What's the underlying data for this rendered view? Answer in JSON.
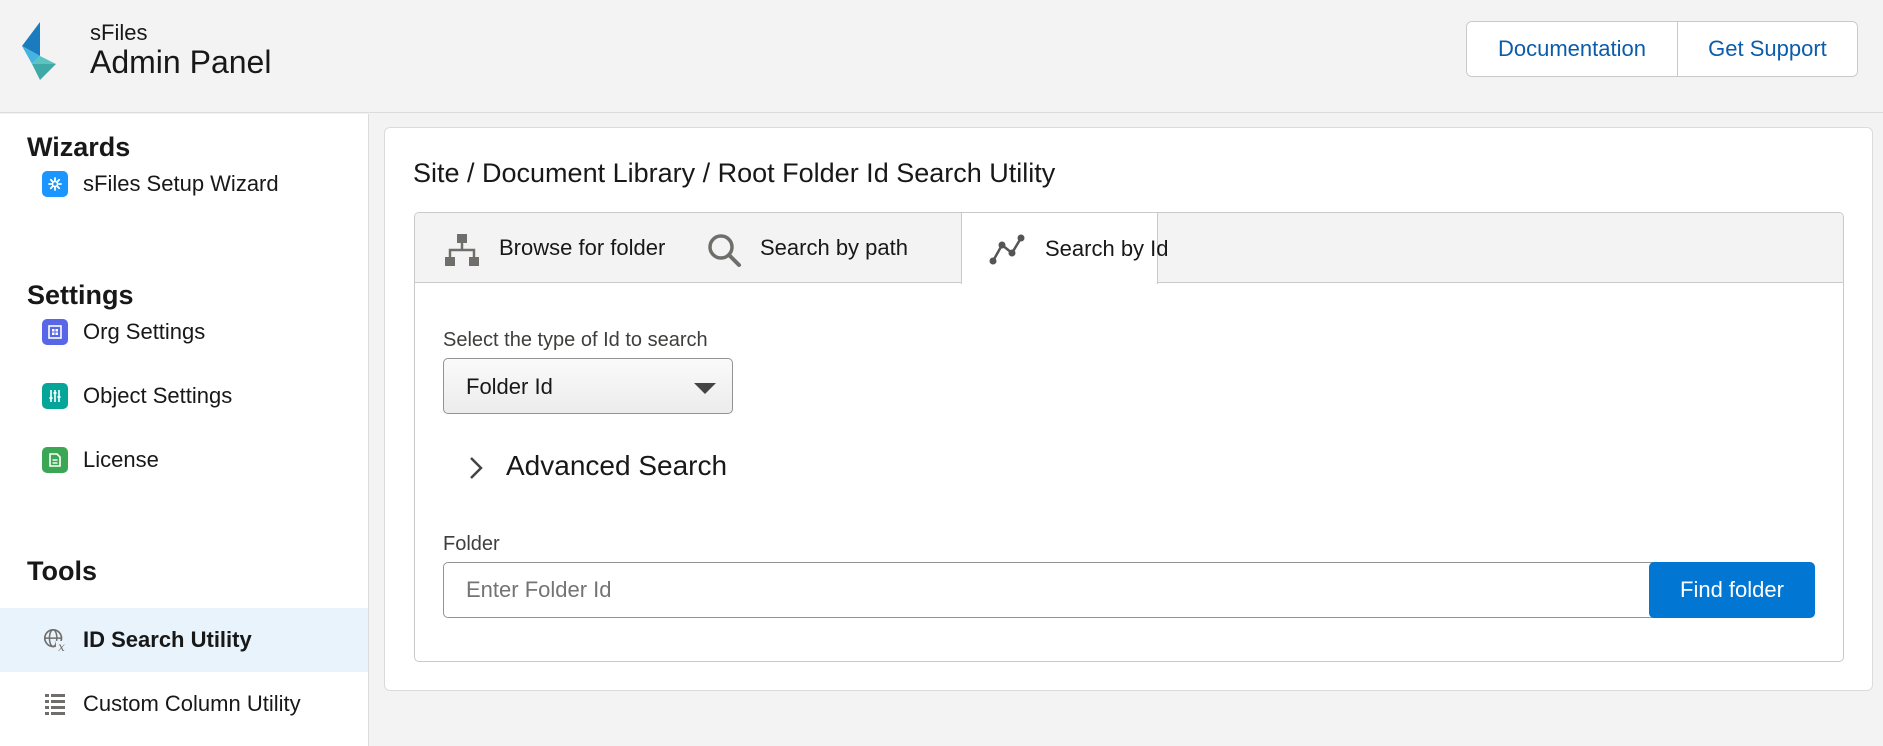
{
  "header": {
    "brand_small": "sFiles",
    "brand_title": "Admin Panel",
    "documentation_label": "Documentation",
    "support_label": "Get Support"
  },
  "sidebar": {
    "sections": [
      {
        "title": "Wizards",
        "items": [
          {
            "label": "sFiles Setup Wizard",
            "icon": "setup-wizard-icon",
            "color": "#1b96ff"
          }
        ]
      },
      {
        "title": "Settings",
        "items": [
          {
            "label": "Org Settings",
            "icon": "org-settings-icon",
            "color": "#5867e8"
          },
          {
            "label": "Object Settings",
            "icon": "object-settings-icon",
            "color": "#06a59a"
          },
          {
            "label": "License",
            "icon": "license-icon",
            "color": "#3ba755"
          }
        ]
      },
      {
        "title": "Tools",
        "items": [
          {
            "label": "ID Search Utility",
            "icon": "globe-function-icon",
            "active": true
          },
          {
            "label": "Custom Column Utility",
            "icon": "table-list-icon"
          }
        ]
      }
    ]
  },
  "main": {
    "breadcrumb": "Site / Document Library / Root Folder Id Search Utility",
    "tabs": [
      {
        "label": "Browse for folder",
        "icon": "hierarchy-icon"
      },
      {
        "label": "Search by path",
        "icon": "search-icon"
      },
      {
        "label": "Search by Id",
        "icon": "graph-line-icon",
        "active": true
      }
    ],
    "id_type_label": "Select the type of Id to search",
    "id_type_value": "Folder Id",
    "advanced_label": "Advanced Search",
    "folder_label": "Folder",
    "folder_placeholder": "Enter Folder Id",
    "find_button": "Find folder"
  },
  "colors": {
    "accent": "#0176d3",
    "link": "#0b5cab",
    "active_nav_bg": "#e8f3fc"
  }
}
